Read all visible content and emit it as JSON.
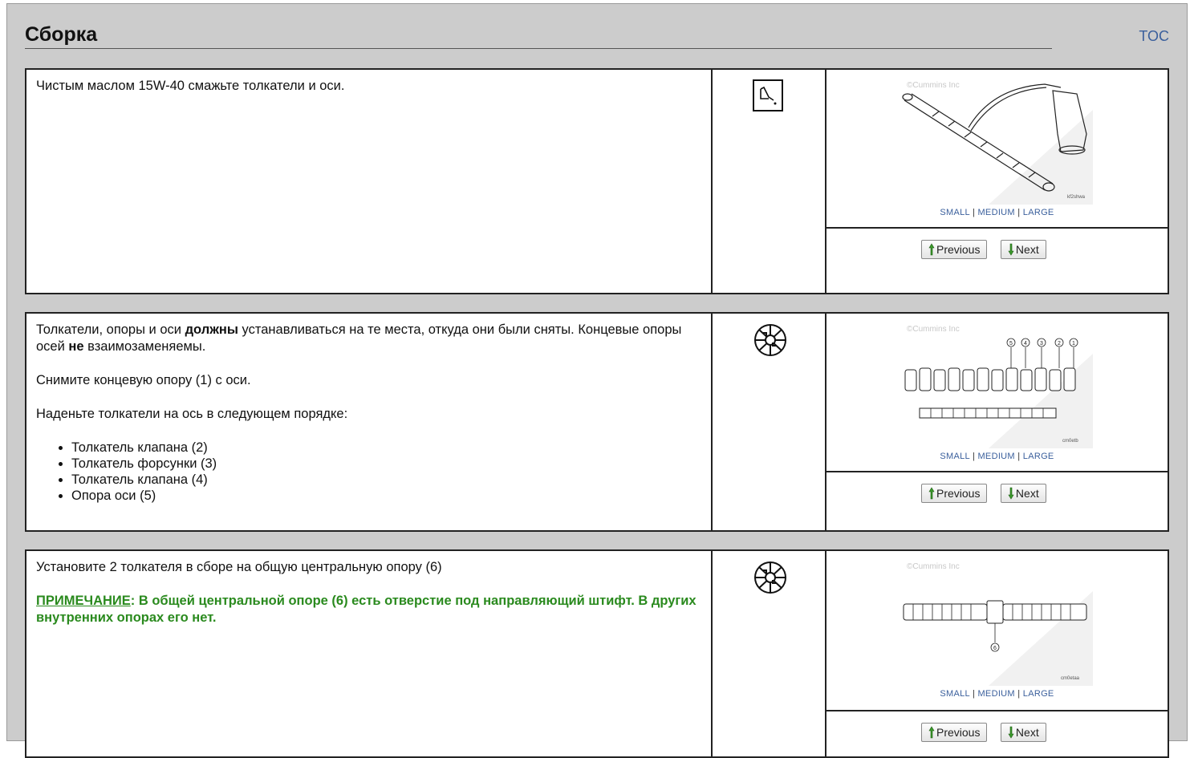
{
  "header": {
    "title": "Сборка",
    "toc": "TOC"
  },
  "colors": {
    "frame": "#cccccc",
    "link": "#3a5f9c",
    "note": "#2a8a1e",
    "arrow_up": "#3a9a2a",
    "arrow_down": "#3a9a2a"
  },
  "nav": {
    "previous": "Previous",
    "next": "Next"
  },
  "image_sizes": {
    "small": "SMALL",
    "medium": "MEDIUM",
    "large": "LARGE",
    "sep": "|"
  },
  "watermark": "©Cummins Inc",
  "steps": [
    {
      "text": "Чистым маслом 15W-40 смажьте толкатели и оси.",
      "tool_icon": "oil-can-icon",
      "figure_code": "kf2shwa"
    },
    {
      "p1_a": "Толкатели, опоры и оси ",
      "p1_b": "должны",
      "p1_c": " устанавливаться на те места, откуда они были сняты. Концевые опоры осей ",
      "p1_d": "не",
      "p1_e": " взаимозаменяемы.",
      "p2": "Снимите концевую опору (1) с оси.",
      "p3": "Наденьте толкатели на ось в следующем порядке:",
      "list": [
        "Толкатель клапана (2)",
        "Толкатель форсунки (3)",
        "Толкатель клапана (4)",
        "Опора оси (5)"
      ],
      "tool_icon": "assembly-icon",
      "figure_code": "cm0etb",
      "callouts": [
        "5",
        "4",
        "3",
        "2",
        "1"
      ]
    },
    {
      "p1": "Установите 2 толкателя в сборе на общую центральную опору (6)",
      "note_label": "ПРИМЕЧАНИЕ",
      "note_text": ": В общей центральной опоре (6) есть отверстие под направляющий штифт. В других внутренних опорах его нет.",
      "tool_icon": "assembly-icon",
      "figure_code": "cm0etaa",
      "callouts": [
        "6"
      ]
    }
  ]
}
